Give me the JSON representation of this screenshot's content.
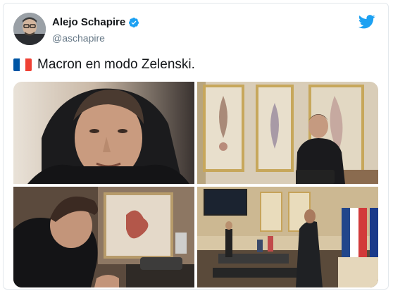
{
  "author": {
    "name": "Alejo Schapire",
    "handle": "@aschapire",
    "verified": true,
    "verified_icon": "verified-badge-icon",
    "avatar_icon": "avatar"
  },
  "brand": {
    "icon": "twitter-bird-icon",
    "color": "#1DA1F2"
  },
  "tweet": {
    "flag_icon": "france-flag-icon",
    "text": "Macron en modo Zelenski."
  },
  "media": {
    "count": 4,
    "photos": [
      {
        "name": "photo-closeup-hoodie"
      },
      {
        "name": "photo-standing-ornate-room"
      },
      {
        "name": "photo-desk-phone"
      },
      {
        "name": "photo-office-meeting"
      }
    ]
  },
  "colors": {
    "text": "#14171a",
    "secondary": "#657786",
    "border": "#e3e8ec"
  }
}
